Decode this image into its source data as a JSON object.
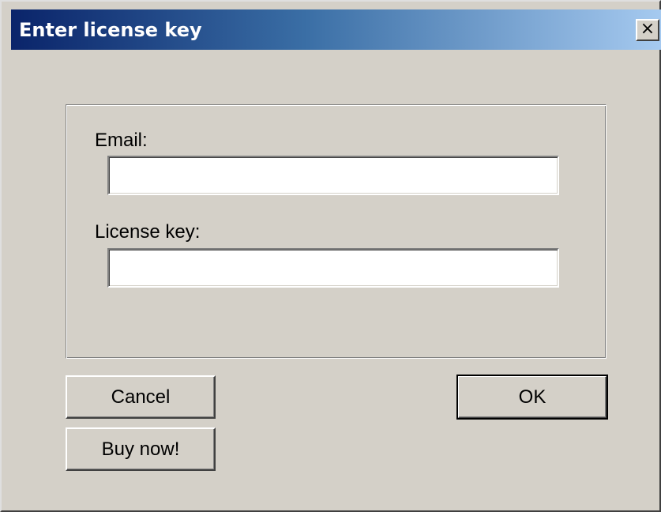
{
  "dialog": {
    "title": "Enter license key",
    "close_label": "×"
  },
  "form": {
    "email_label": "Email:",
    "email_value": "",
    "license_label": "License key:",
    "license_value": ""
  },
  "buttons": {
    "cancel": "Cancel",
    "buy_now": "Buy now!",
    "ok": "OK"
  },
  "icons": {
    "close": "close-icon"
  },
  "colors": {
    "title_bar_start": "#0a246a",
    "title_bar_end": "#a6caf0",
    "dialog_face": "#d4d0c8",
    "field_background": "#ffffff"
  }
}
